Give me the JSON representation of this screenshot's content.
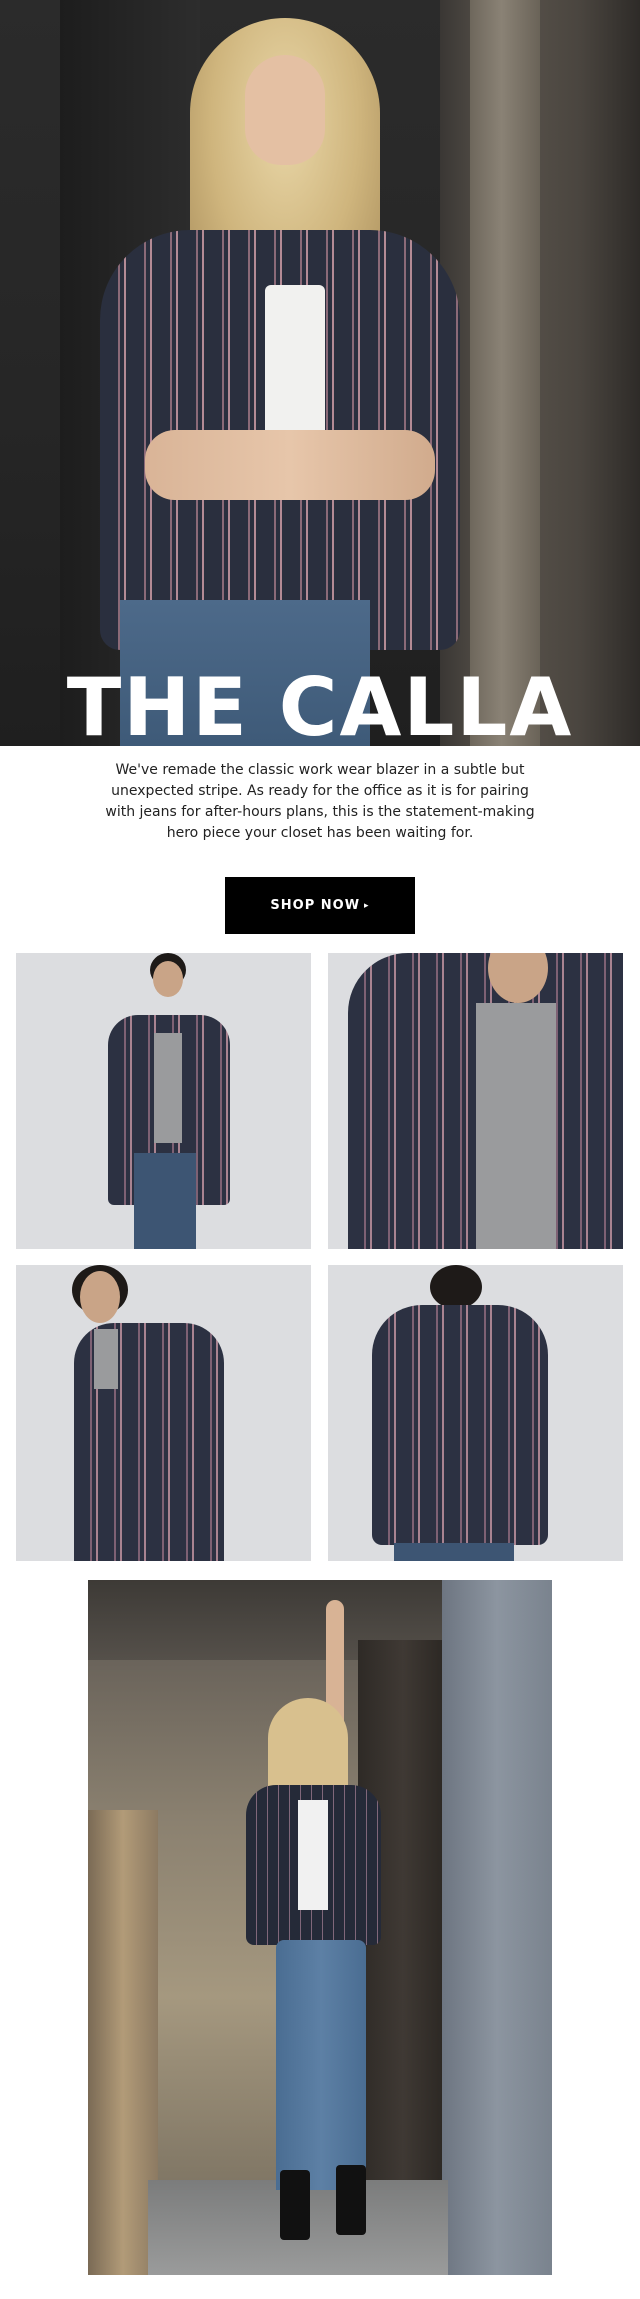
{
  "hero": {
    "title": "THE CALLA",
    "image_alt": "Model in navy striped blazer leaning against a doorway"
  },
  "intro": {
    "text": "We've remade the classic work wear blazer in a subtle but unexpected stripe. As ready for the office as it is for pairing with jeans for after-hours plans, this is the statement-making hero piece your closet has been waiting for."
  },
  "cta": {
    "label": "SHOP NOW",
    "caret": "▸"
  },
  "grid": {
    "tiles": [
      "Front view of blazer over grey tee and jeans",
      "Close-up of blazer lapel and button",
      "Side view of blazer",
      "Back view of blazer"
    ]
  },
  "lifestyle": {
    "image_alt": "Model in blazer, white tee, jeans and black boots in an industrial doorway"
  },
  "colors": {
    "background": "#ffffff",
    "button": "#000000",
    "button_text": "#ffffff",
    "blazer_navy": "#2a2f3e",
    "stripe_rose": "#b48b96"
  }
}
